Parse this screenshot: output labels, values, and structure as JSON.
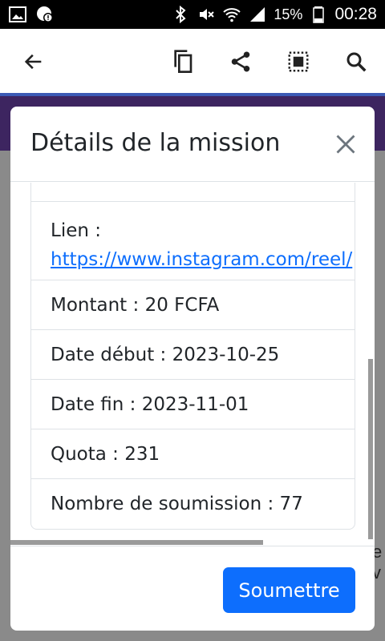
{
  "status_bar": {
    "battery_percent": "15%",
    "time": "00:28",
    "icons": [
      "gallery-icon",
      "notification-icon",
      "bluetooth-icon",
      "mute-icon",
      "wifi-icon",
      "signal-icon",
      "battery-icon"
    ]
  },
  "toolbar": {
    "icons": [
      "back-arrow-icon",
      "copy-icon",
      "share-icon",
      "select-all-icon",
      "search-icon"
    ]
  },
  "modal": {
    "title": "Détails de la mission",
    "items": {
      "lien_label": "Lien :",
      "lien_url": "https://www.instagram.com/reel/",
      "montant": "Montant : 20 FCFA",
      "date_debut": "Date début : 2023-10-25",
      "date_fin": "Date fin : 2023-11-01",
      "quota": "Quota : 231",
      "nombre_soumission": "Nombre de soumission : 77"
    },
    "submit_label": "Soumettre"
  },
  "background": {
    "peek_text": "e v"
  },
  "colors": {
    "accent": "#0d6efd",
    "toolbar_underline": "#3b5bb5",
    "header_band": "#3d2560"
  }
}
